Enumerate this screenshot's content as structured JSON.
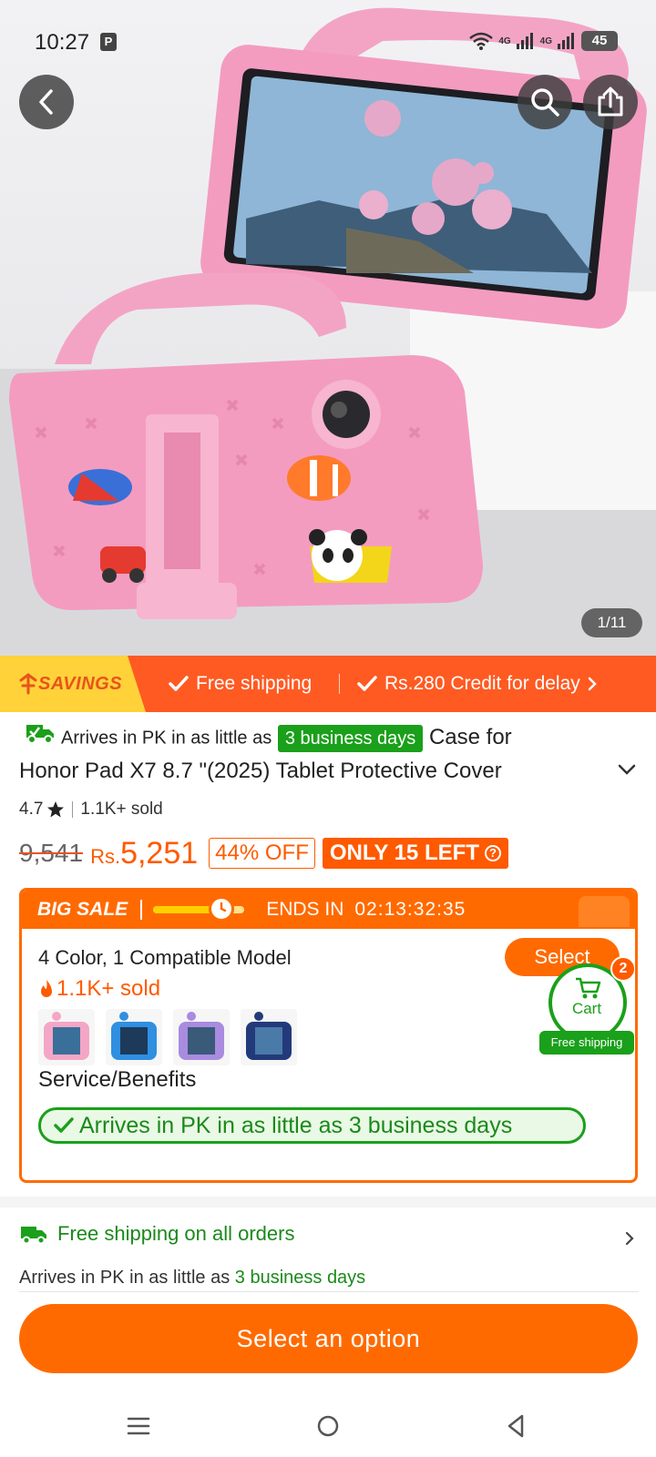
{
  "status_bar": {
    "time": "10:27",
    "p_badge": "P",
    "sig1": "4G",
    "sig2": "4G",
    "battery": "45"
  },
  "gallery": {
    "counter": "1/11"
  },
  "savings": {
    "tag": "SAVINGS",
    "item1": "Free shipping",
    "item2": "Rs.280 Credit for delay"
  },
  "product": {
    "arrives_prefix": "Arrives in PK in as little as",
    "arrives_days": "3 business days",
    "title_line1": "Case for",
    "title_line2": "Honor Pad X7 8.7 \"(2025) Tablet Protective Cover",
    "rating": "4.7",
    "sold": "1.1K+ sold",
    "old_price": "9,541",
    "currency": "Rs.",
    "price": "5,251",
    "discount": "44% OFF",
    "stock": "ONLY 15 LEFT"
  },
  "sale": {
    "title": "BIG SALE",
    "ends_label": "ENDS IN",
    "ends_time": "02:13:32:35",
    "progress": 0.75,
    "variant_summary": "4 Color, 1 Compatible Model",
    "variant_sold": "1.1K+ sold",
    "select_label": "Select",
    "thumb_colors": [
      "#f4a6c6",
      "#2f8fe0",
      "#a98be0",
      "#233a7a"
    ],
    "service_title": "Service/Benefits",
    "service_benefit": "Arrives in PK in as little as 3 business days"
  },
  "cart": {
    "label": "Cart",
    "count": "2",
    "free_label": "Free shipping"
  },
  "shipping": {
    "title": "Free shipping on all orders",
    "sub_prefix": "Arrives in PK in as little as",
    "sub_days": "3 business days"
  },
  "cta": {
    "label": "Select an option"
  },
  "colors": {
    "accent": "#ff6a00",
    "green": "#1aa01a",
    "savings_yellow": "#ffd23a"
  }
}
